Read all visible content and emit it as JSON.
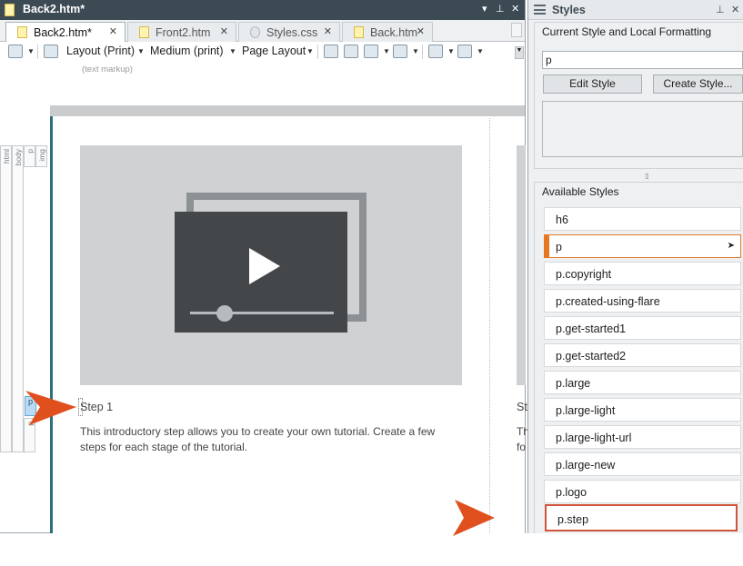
{
  "editor": {
    "window_title": "Back2.htm*",
    "tabs": [
      {
        "label": "Back2.htm*",
        "active": true
      },
      {
        "label": "Front2.htm",
        "active": false
      },
      {
        "label": "Styles.css",
        "active": false
      },
      {
        "label": "Back.htm",
        "active": false
      }
    ],
    "toolbar": {
      "layout_label": "Layout (Print)",
      "medium_label": "Medium (print)",
      "page_layout_label": "Page Layout"
    },
    "hint": "(text markup)",
    "tag_bar": [
      "html",
      "body",
      "p",
      "img"
    ],
    "selected_tag": "p",
    "content": {
      "step_title": "Step 1",
      "step_body": "This introductory step allows you to create your own tutorial. Create a few steps for each stage of the tutorial.",
      "step_title_2": "St",
      "step_body_2_l1": "Th",
      "step_body_2_l2": "fo"
    }
  },
  "styles_pane": {
    "title": "Styles",
    "current_heading": "Current Style and Local Formatting",
    "current_value": "p",
    "edit_style_label": "Edit Style",
    "create_style_label": "Create Style...",
    "available_heading": "Available Styles",
    "items": [
      "h6",
      "p",
      "p.copyright",
      "p.created-using-flare",
      "p.get-started1",
      "p.get-started2",
      "p.large",
      "p.large-light",
      "p.large-light-url",
      "p.large-new",
      "p.logo",
      "p.step"
    ],
    "current_item": "p",
    "highlighted_item": "p.step"
  },
  "colors": {
    "titlebar": "#3c4a53",
    "accent_orange": "#e87722",
    "highlight_border": "#d0553a",
    "arrow": "#e0501e"
  }
}
